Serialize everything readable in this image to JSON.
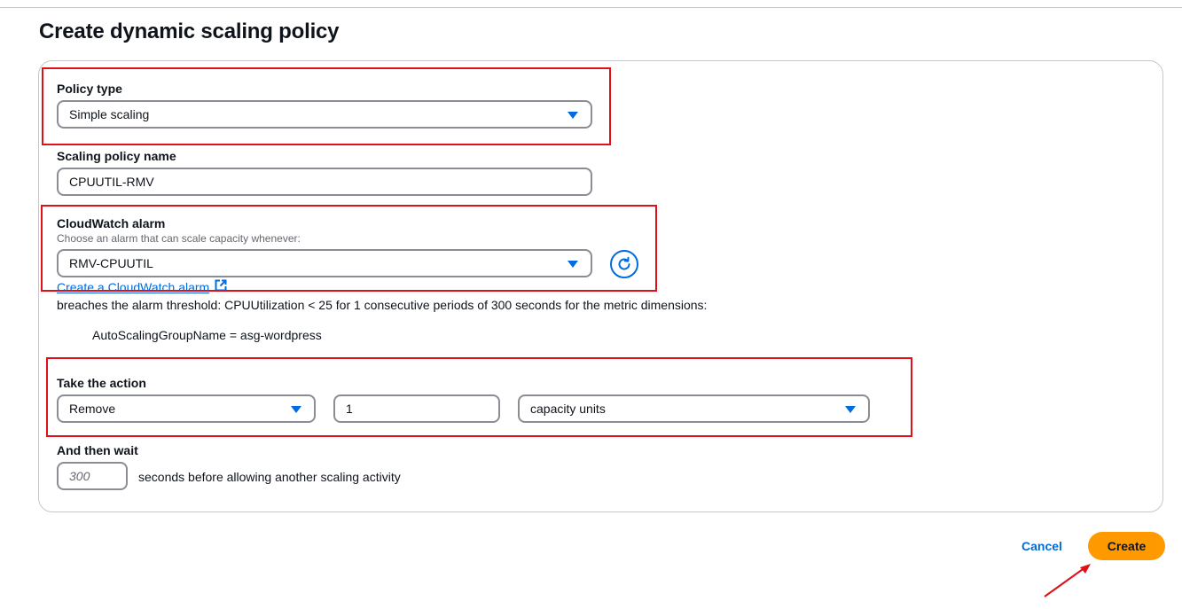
{
  "page": {
    "title": "Create dynamic scaling policy"
  },
  "policy_type": {
    "label": "Policy type",
    "selected": "Simple scaling"
  },
  "policy_name": {
    "label": "Scaling policy name",
    "value": "CPUUTIL-RMV"
  },
  "alarm": {
    "label": "CloudWatch alarm",
    "description": "Choose an alarm that can scale capacity whenever:",
    "selected": "RMV-CPUUTIL",
    "create_link": "Create a CloudWatch alarm",
    "breach_text": "breaches the alarm threshold: CPUUtilization < 25 for 1 consecutive periods of 300 seconds for the metric dimensions:",
    "dimension": "AutoScalingGroupName = asg-wordpress"
  },
  "action": {
    "label": "Take the action",
    "operation": "Remove",
    "amount": "1",
    "unit": "capacity units"
  },
  "wait": {
    "label": "And then wait",
    "placeholder": "300",
    "suffix": "seconds before allowing another scaling activity"
  },
  "footer": {
    "cancel": "Cancel",
    "create": "Create"
  },
  "icons": {
    "refresh": "refresh-icon",
    "external": "external-link-icon",
    "caret": "caret-down-icon"
  },
  "colors": {
    "accent": "#006ce0",
    "primary_button": "#ff9900",
    "annotation": "#e0101a"
  }
}
